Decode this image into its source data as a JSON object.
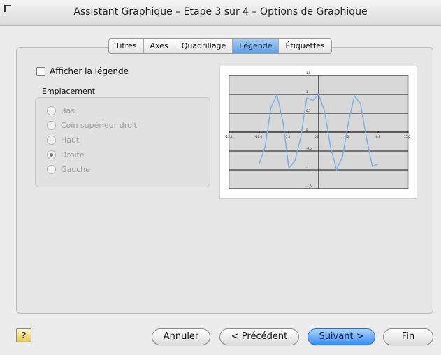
{
  "window": {
    "title": "Assistant Graphique – Étape 3 sur 4 – Options de Graphique"
  },
  "tabs": [
    {
      "label": "Titres",
      "active": false
    },
    {
      "label": "Axes",
      "active": false
    },
    {
      "label": "Quadrillage",
      "active": false
    },
    {
      "label": "Légende",
      "active": true
    },
    {
      "label": "Étiquettes",
      "active": false
    }
  ],
  "legend_options": {
    "show_legend_label": "Afficher la légende",
    "show_legend_checked": false,
    "placement_label": "Emplacement",
    "positions": [
      {
        "label": "Bas",
        "selected": false
      },
      {
        "label": "Coin supérieur droit",
        "selected": false
      },
      {
        "label": "Haut",
        "selected": false
      },
      {
        "label": "Droite",
        "selected": true
      },
      {
        "label": "Gauche",
        "selected": false
      }
    ]
  },
  "preview": {
    "line_color": "#7fb0e8",
    "y_ticks": [
      "1,5",
      "1",
      "0,5",
      "0",
      "-0,5",
      "-1",
      "-1,5"
    ],
    "x_ticks": [
      "-15,0",
      "-10,0",
      "-5,0",
      "0,0",
      "5,0",
      "10,0",
      "15,0"
    ]
  },
  "chart_data": {
    "type": "line",
    "title": "",
    "xlabel": "",
    "ylabel": "",
    "xlim": [
      -15,
      15
    ],
    "ylim": [
      -1.5,
      1.5
    ],
    "grid": true,
    "series": [
      {
        "x": [
          -10,
          -9,
          -8,
          -7,
          -6,
          -5,
          -4,
          -3,
          -2,
          -1,
          0,
          1,
          2,
          3,
          4,
          5,
          6,
          7,
          8,
          9,
          10
        ],
        "values": [
          -0.84,
          -0.41,
          0.65,
          0.99,
          0.28,
          -0.96,
          -0.76,
          -0.14,
          0.91,
          0.84,
          1.0,
          0.54,
          -0.42,
          -0.99,
          -0.65,
          0.28,
          0.96,
          0.75,
          -0.15,
          -0.91,
          -0.84
        ]
      }
    ]
  },
  "buttons": {
    "help": "?",
    "cancel": "Annuler",
    "previous": "< Précédent",
    "next": "Suivant >",
    "finish": "Fin"
  }
}
